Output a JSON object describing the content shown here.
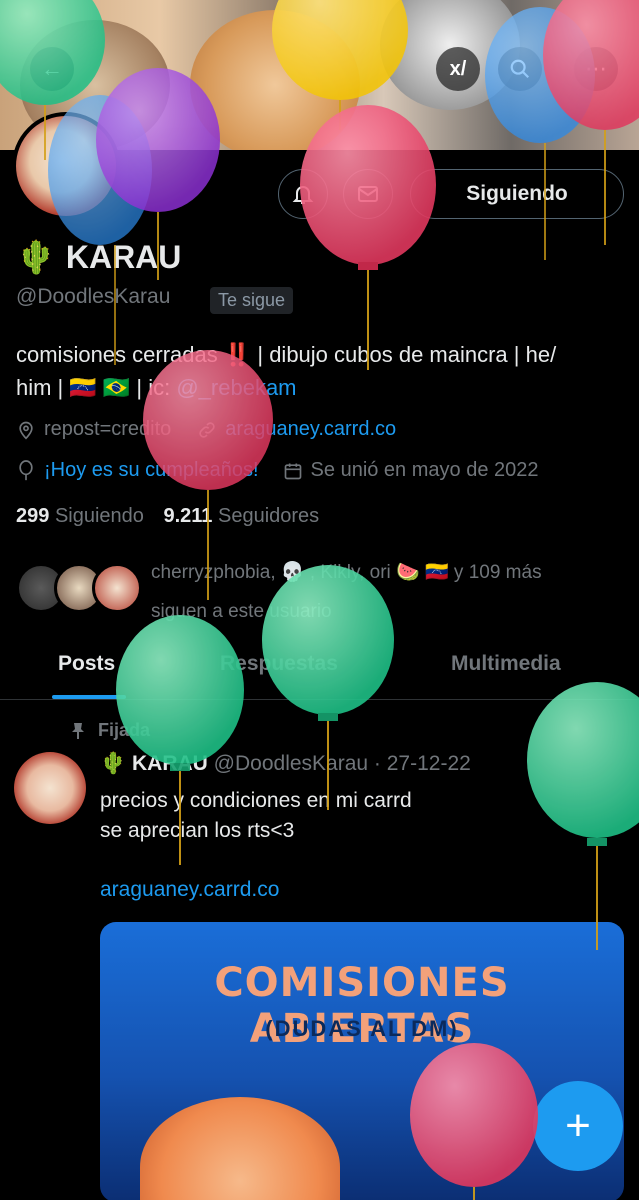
{
  "header": {
    "back_icon": "arrow-left-icon",
    "grok_icon": "grok-icon",
    "search_icon": "search-icon",
    "more_icon": "more-icon"
  },
  "profile": {
    "name_emoji": "🌵",
    "name": "KARAU",
    "handle": "@DoodlesKarau",
    "follows_you": "Te sigue",
    "follow_button": "Siguiendo",
    "bio_line1": "comisiones cerradas ‼️ | dibujo cubos de maincra | he/",
    "bio_line2": "him | 🇻🇪 🇧🇷 | ic: ",
    "bio_mention": "@_rebekam",
    "location": "repost=credito",
    "website": "araguaney.carrd.co",
    "birthday": "¡Hoy es su cumpleaños!",
    "joined": "Se unió en mayo de 2022",
    "following_count": "299",
    "following_label": "Siguiendo",
    "followers_count": "9.211",
    "followers_label": "Seguidores",
    "known_line1": "cherryzphobia, 💀 , Kikly, ori 🍉 🇻🇪 y 109 más",
    "known_line2": "siguen a este usuario"
  },
  "tabs": [
    "Posts",
    "Respuestas",
    "Multimedia"
  ],
  "post": {
    "pinned_label": "Fijada",
    "author_emoji": "🌵",
    "author": "KARAU",
    "handle_date": "@DoodlesKarau · 27-12-22",
    "line1": "precios y condiciones en mi carrd",
    "line2": "se aprecian los rts<3",
    "link": "araguaney.carrd.co",
    "card_title": "COMISIONES ABIERTAS",
    "card_sub": "(DUDAS AL DM)"
  },
  "fab_label": "+",
  "colors": {
    "accent": "#1d9bf0",
    "background": "#000000",
    "muted": "#71767b"
  }
}
